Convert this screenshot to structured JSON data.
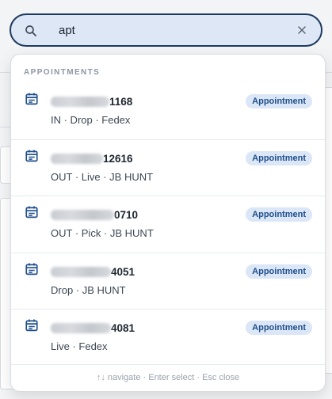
{
  "search": {
    "value": "apt"
  },
  "dropdown": {
    "section_header": "APPOINTMENTS",
    "results": [
      {
        "title_suffix": "1168",
        "subtitle": "IN · Drop · Fedex",
        "badge": "Appointment"
      },
      {
        "title_suffix": "12616",
        "subtitle": "OUT · Live · JB HUNT",
        "badge": "Appointment"
      },
      {
        "title_suffix": "0710",
        "subtitle": "OUT · Pick · JB HUNT",
        "badge": "Appointment"
      },
      {
        "title_suffix": "4051",
        "subtitle": "Drop · JB HUNT",
        "badge": "Appointment"
      },
      {
        "title_suffix": "4081",
        "subtitle": "Live · Fedex",
        "badge": "Appointment"
      }
    ],
    "footer_hint": "↑↓ navigate · Enter select · Esc close"
  },
  "icons": {
    "search": "search-icon",
    "clear": "close-icon",
    "result": "calendar-icon"
  },
  "colors": {
    "accent": "#1f3a5f",
    "badge_bg": "#dbe7f6",
    "badge_text": "#1f4e8c"
  }
}
